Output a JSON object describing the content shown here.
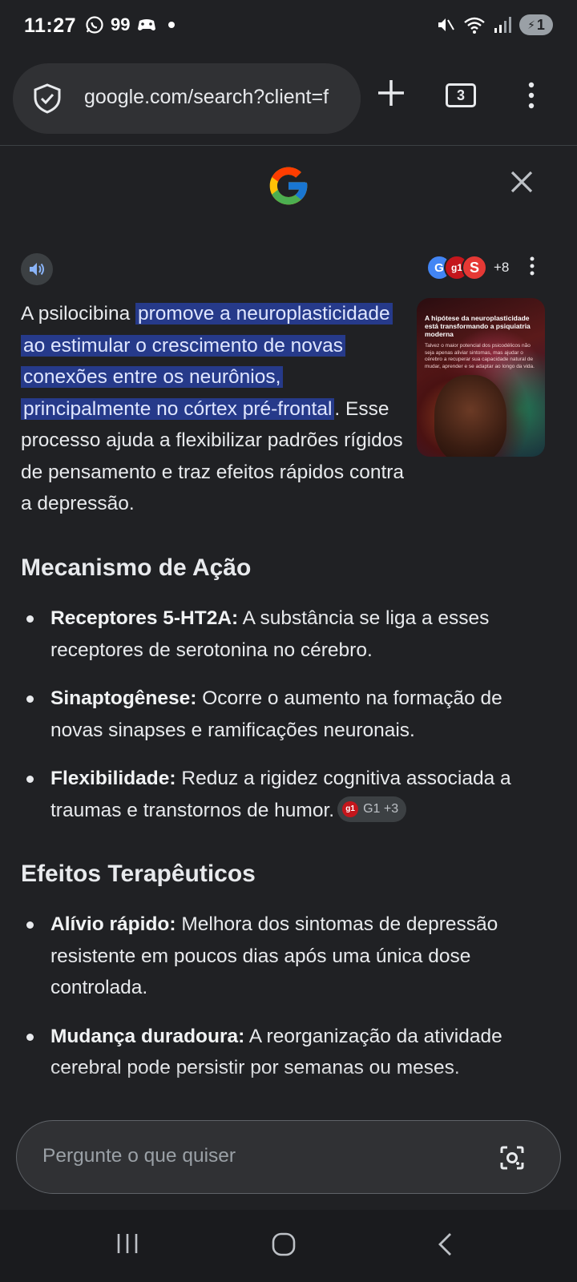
{
  "status_bar": {
    "time": "11:27",
    "battery": "1",
    "notification_count": "99"
  },
  "browser": {
    "url": "google.com/search?client=f",
    "tab_count": "3"
  },
  "panel": {
    "sources_more": "+8",
    "answer": {
      "before": "A psilocibina ",
      "highlight": "promove a neuroplasticidade ao estimular o crescimento de novas conexões entre os neurônios, principalmente no córtex pré-frontal",
      "after": ". Esse processo ajuda a flexibilizar padrões rígidos de pensamento e traz efeitos rápidos contra a depressão."
    },
    "thumbnail": {
      "title": "A hipótese da neuroplasticidade está transformando a psiquiatria moderna",
      "body": "Talvez o maior potencial dos psicodélicos não seja apenas aliviar sintomas, mas ajudar o cérebro a recuperar sua capacidade natural de mudar, aprender e se adaptar ao longo da vida."
    },
    "sections": [
      {
        "title": "Mecanismo de Ação",
        "items": [
          {
            "term": "Receptores 5-HT2A:",
            "text": " A substância se liga a esses receptores de serotonina no cérebro."
          },
          {
            "term": "Sinaptogênese:",
            "text": " Ocorre o aumento na formação de novas sinapses e ramificações neuronais."
          },
          {
            "term": "Flexibilidade:",
            "text": " Reduz a rigidez cognitiva associada a traumas e transtornos de humor."
          }
        ],
        "citation": {
          "badge": "g1",
          "label": "G1 +3"
        }
      },
      {
        "title": "Efeitos Terapêuticos",
        "items": [
          {
            "term": "Alívio rápido:",
            "text": " Melhora dos sintomas de depressão resistente em poucos dias após uma única dose controlada."
          },
          {
            "term": "Mudança duradoura:",
            "text": " A reorganização da atividade cerebral pode persistir por semanas ou meses."
          }
        ]
      }
    ],
    "ask_placeholder": "Pergunte o que quiser"
  },
  "colors": {
    "background": "#202124",
    "highlight": "#263a8a",
    "text": "#e8eaed"
  }
}
